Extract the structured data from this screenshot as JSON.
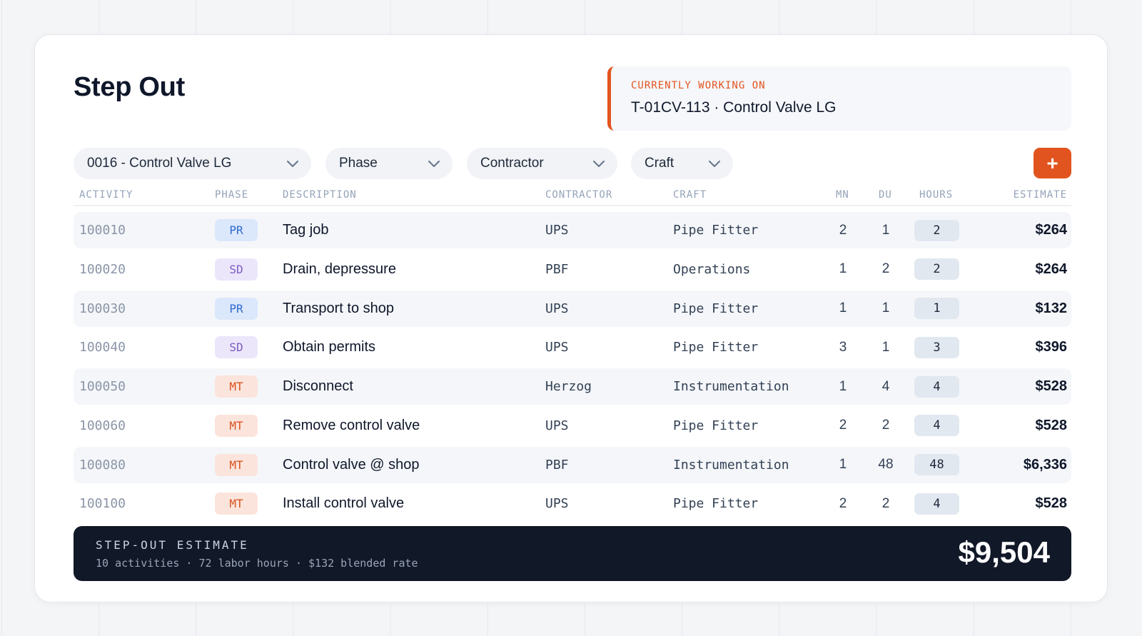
{
  "page": {
    "title": "Step Out"
  },
  "current": {
    "label": "CURRENTLY WORKING ON",
    "value": "T-01CV-113 · Control Valve LG"
  },
  "filters": {
    "item": "0016 - Control Valve LG",
    "phase": "Phase",
    "contractor": "Contractor",
    "craft": "Craft",
    "add_label": "+"
  },
  "table": {
    "headers": {
      "activity": "ACTIVITY",
      "phase": "PHASE",
      "description": "DESCRIPTION",
      "contractor": "CONTRACTOR",
      "craft": "CRAFT",
      "mn": "MN",
      "du": "DU",
      "hours": "HOURS",
      "estimate": "ESTIMATE"
    },
    "rows": [
      {
        "activity": "100010",
        "phase": "PR",
        "description": "Tag job",
        "contractor": "UPS",
        "craft": "Pipe Fitter",
        "mn": "2",
        "du": "1",
        "hours": "2",
        "estimate": "$264"
      },
      {
        "activity": "100020",
        "phase": "SD",
        "description": "Drain, depressure",
        "contractor": "PBF",
        "craft": "Operations",
        "mn": "1",
        "du": "2",
        "hours": "2",
        "estimate": "$264"
      },
      {
        "activity": "100030",
        "phase": "PR",
        "description": "Transport to shop",
        "contractor": "UPS",
        "craft": "Pipe Fitter",
        "mn": "1",
        "du": "1",
        "hours": "1",
        "estimate": "$132"
      },
      {
        "activity": "100040",
        "phase": "SD",
        "description": "Obtain permits",
        "contractor": "UPS",
        "craft": "Pipe Fitter",
        "mn": "3",
        "du": "1",
        "hours": "3",
        "estimate": "$396"
      },
      {
        "activity": "100050",
        "phase": "MT",
        "description": "Disconnect",
        "contractor": "Herzog",
        "craft": "Instrumentation",
        "mn": "1",
        "du": "4",
        "hours": "4",
        "estimate": "$528"
      },
      {
        "activity": "100060",
        "phase": "MT",
        "description": "Remove control valve",
        "contractor": "UPS",
        "craft": "Pipe Fitter",
        "mn": "2",
        "du": "2",
        "hours": "4",
        "estimate": "$528"
      },
      {
        "activity": "100080",
        "phase": "MT",
        "description": "Control valve @ shop",
        "contractor": "PBF",
        "craft": "Instrumentation",
        "mn": "1",
        "du": "48",
        "hours": "48",
        "estimate": "$6,336"
      },
      {
        "activity": "100100",
        "phase": "MT",
        "description": "Install control valve",
        "contractor": "UPS",
        "craft": "Pipe Fitter",
        "mn": "2",
        "du": "2",
        "hours": "4",
        "estimate": "$528"
      }
    ]
  },
  "phase_colors": {
    "PR": {
      "bg": "#dbe7fb",
      "fg": "#2f6bd0"
    },
    "SD": {
      "bg": "#ece6fb",
      "fg": "#7c5cc4"
    },
    "MT": {
      "bg": "#fbe4dc",
      "fg": "#d9541f"
    }
  },
  "summary": {
    "label": "STEP-OUT ESTIMATE",
    "detail": "10 activities · 72 labor hours · $132 blended rate",
    "total": "$9,504"
  },
  "colors": {
    "accent": "#e2541f",
    "footer_bg": "#111827"
  }
}
